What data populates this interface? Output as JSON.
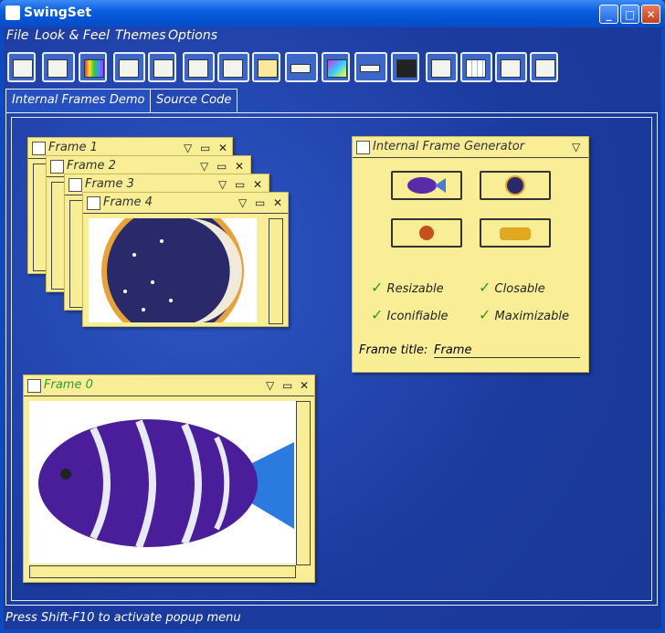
{
  "window": {
    "title": "SwingSet",
    "minimize": "_",
    "maximize": "□",
    "close": "✕"
  },
  "menu": [
    "File",
    "Look & Feel",
    "Themes",
    "Options"
  ],
  "toolbar_icons": [
    "internal-frame-icon",
    "checkbox-radio-icon",
    "color-chooser-icon",
    "combobox-icon",
    "file-chooser-icon",
    "editor-pane-icon",
    "list-icon",
    "option-pane-icon",
    "progress-bar-icon",
    "scroll-pane-icon",
    "slider-icon",
    "split-pane-icon",
    "tabbed-pane-icon",
    "table-icon",
    "tooltip-icon",
    "tree-icon"
  ],
  "tabs": {
    "demo": "Internal Frames Demo",
    "source": "Source Code"
  },
  "frames": {
    "f1": "Frame 1",
    "f2": "Frame 2",
    "f3": "Frame 3",
    "f4": "Frame 4",
    "f0": "Frame 0",
    "controls": {
      "iconify": "▽",
      "maximize": "▭",
      "close": "✕"
    }
  },
  "generator": {
    "title": "Internal Frame Generator",
    "menu_glyph": "▽",
    "options": {
      "resizable": "Resizable",
      "closable": "Closable",
      "iconifiable": "Iconifiable",
      "maximizable": "Maximizable"
    },
    "frame_title_label": "Frame title:",
    "frame_title_value": "Frame"
  },
  "status": "Press Shift-F10 to activate popup menu"
}
